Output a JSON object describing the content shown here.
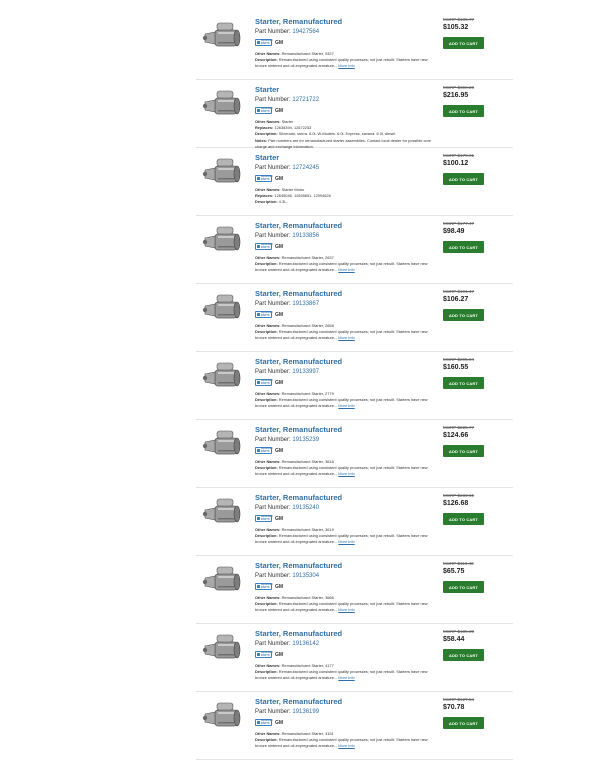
{
  "labels": {
    "part_number": "Part Number:",
    "other_names": "Other Names:",
    "replaces": "Replaces:",
    "description": "Description:",
    "notes": "Notes:",
    "more_info": "More Info",
    "add_to_cart": "ADD TO CART",
    "brand_logo": "GENUINE PARTS",
    "brand": "GM"
  },
  "colors": {
    "link": "#2f6fa7",
    "cart_button": "#2a7d2e",
    "logo": "#3b7fc4"
  },
  "products": [
    {
      "title": "Starter, Remanufactured",
      "part_number": "19427564",
      "msrp": "MSRP $189.77",
      "price": "$105.32",
      "other_names": "Remanufactured Starter, 9327",
      "description": "Remanufactured using consistent quality processes; not just rebuilt. Starters have new bronze sintered and oil-impregnated armature...",
      "icon": "starter-motor-icon"
    },
    {
      "title": "Starter",
      "part_number": "12721722",
      "msrp": "MSRP $390.86",
      "price": "$216.95",
      "other_names": "Starter",
      "replaces": "12638394, 12672253",
      "description": "Silverado, sierra. 6.0l. W-Models. 6.0l. Express, savana. 6.0l, diesel.",
      "notes": "Part numbers are for remanufactured starter assemblies. Contact local dealer for possible core charge and exchange information.",
      "icon": "starter-motor-icon"
    },
    {
      "title": "Starter",
      "part_number": "12724245",
      "msrp": "MSRP $178.01",
      "price": "$100.12",
      "other_names": "Starter Motor",
      "replaces": "12645046, 12655851, 12094626",
      "description": "4.3L.",
      "icon": "starter-motor-icon"
    },
    {
      "title": "Starter, Remanufactured",
      "part_number": "19133856",
      "msrp": "MSRP $177.47",
      "price": "$98.49",
      "other_names": "Remanufactured Starter, 2637",
      "description": "Remanufactured using consistent quality processes; not just rebuilt. Starters have new bronze sintered and oil-impregnated armature...",
      "icon": "starter-motor-icon"
    },
    {
      "title": "Starter, Remanufactured",
      "part_number": "19133867",
      "msrp": "MSRP $191.47",
      "price": "$106.27",
      "other_names": "Remanufactured Starter, 2658",
      "description": "Remanufactured using consistent quality processes; not just rebuilt. Starters have new bronze sintered and oil-impregnated armature...",
      "icon": "starter-motor-icon"
    },
    {
      "title": "Starter, Remanufactured",
      "part_number": "19133997",
      "msrp": "MSRP $295.94",
      "price": "$160.55",
      "other_names": "Remanufactured Starter, 2779",
      "description": "Remanufactured using consistent quality processes; not just rebuilt. Starters have new bronze sintered and oil-impregnated armature...",
      "icon": "starter-motor-icon"
    },
    {
      "title": "Starter, Remanufactured",
      "part_number": "19135239",
      "msrp": "MSRP $225.77",
      "price": "$124.66",
      "other_names": "Remanufactured Starter, 3618",
      "description": "Remanufactured using consistent quality processes; not just rebuilt. Starters have new bronze sintered and oil-impregnated armature...",
      "icon": "starter-motor-icon"
    },
    {
      "title": "Starter, Remanufactured",
      "part_number": "19135240",
      "msrp": "MSRP $233.51",
      "price": "$126.68",
      "other_names": "Remanufactured Starter, 3619",
      "description": "Remanufactured using consistent quality processes; not just rebuilt. Starters have new bronze sintered and oil-impregnated armature...",
      "icon": "starter-motor-icon"
    },
    {
      "title": "Starter, Remanufactured",
      "part_number": "19135304",
      "msrp": "MSRP $118.46",
      "price": "$65.75",
      "other_names": "Remanufactured Starter, 3666",
      "description": "Remanufactured using consistent quality processes; not just rebuilt. Starters have new bronze sintered and oil-impregnated armature...",
      "icon": "starter-motor-icon"
    },
    {
      "title": "Starter, Remanufactured",
      "part_number": "19136142",
      "msrp": "MSRP $105.29",
      "price": "$58.44",
      "other_names": "Remanufactured Starter, 4177",
      "description": "Remanufactured using consistent quality processes; not just rebuilt. Starters have new bronze sintered and oil-impregnated armature...",
      "icon": "starter-motor-icon"
    },
    {
      "title": "Starter, Remanufactured",
      "part_number": "19136199",
      "msrp": "MSRP $127.54",
      "price": "$70.78",
      "other_names": "Remanufactured Starter, 4151",
      "description": "Remanufactured using consistent quality processes; not just rebuilt. Starters have new bronze sintered and oil-impregnated armature...",
      "icon": "starter-motor-icon"
    }
  ]
}
